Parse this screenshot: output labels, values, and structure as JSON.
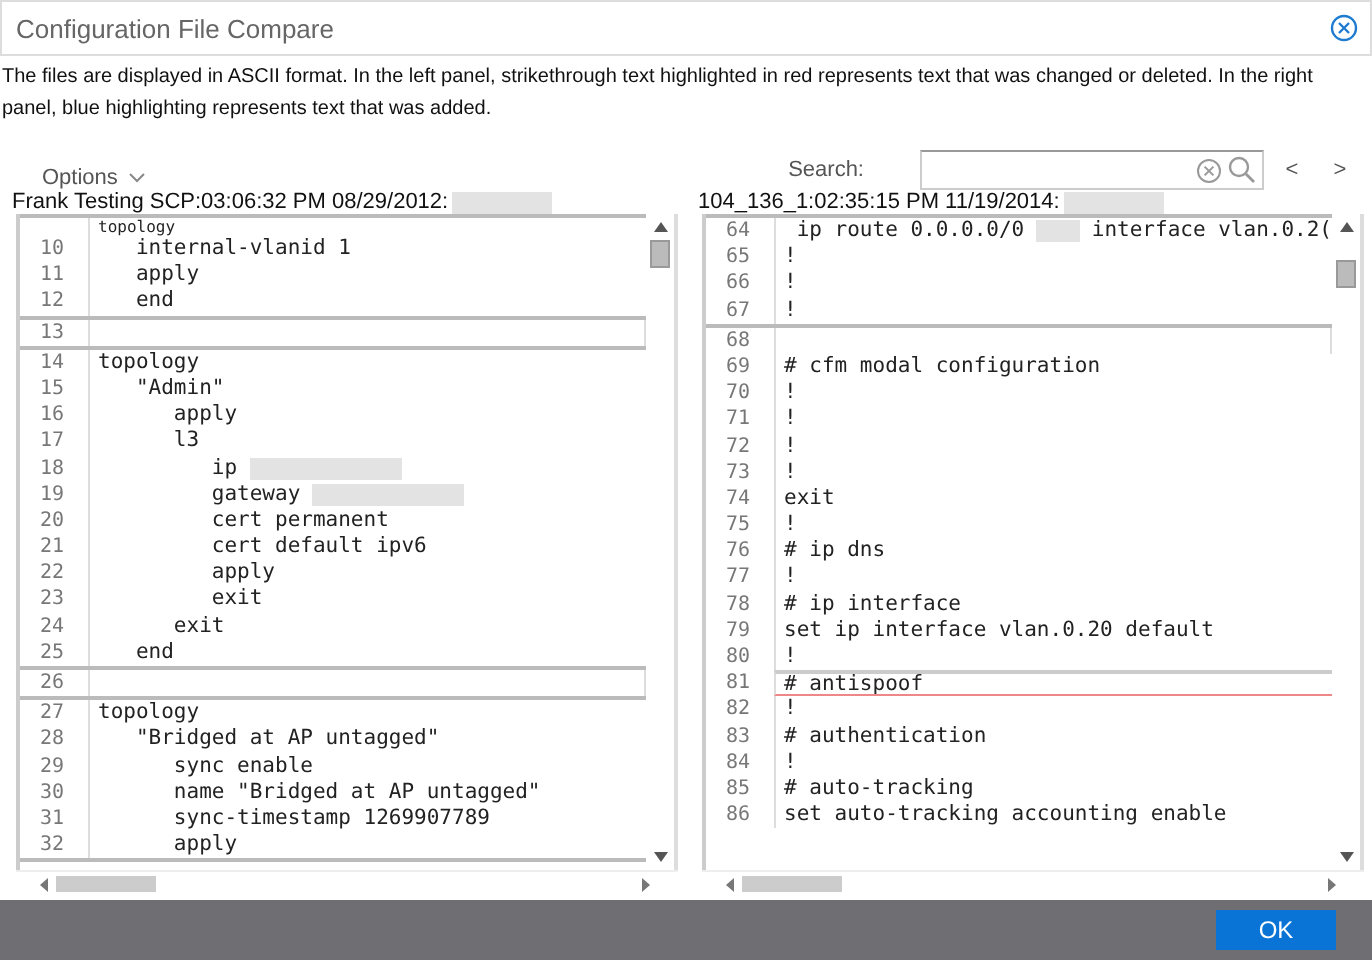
{
  "window": {
    "title": "Configuration File Compare"
  },
  "description": "The files are displayed in ASCII format. In the left panel, strikethrough text highlighted in red represents text that was changed or deleted. In the right panel, blue highlighting represents text that was added.",
  "toolbar": {
    "options": "Options",
    "search_label": "Search:",
    "prev": "<",
    "next": ">"
  },
  "panels": [
    {
      "file": "Frank Testing SCP:03:06:32 PM 08/29/2012:",
      "file_redacted": true,
      "blocks": [
        {
          "kind": "block",
          "lines": [
            {
              "parts": [
                {
                  "kind": "text",
                  "text": "topology"
                }
              ]
            },
            {
              "number": "10",
              "parts": [
                {
                  "kind": "text",
                  "text": "   internal-vlanid 1"
                }
              ]
            },
            {
              "number": "11",
              "parts": [
                {
                  "kind": "text",
                  "text": "   apply"
                }
              ]
            },
            {
              "number": "12",
              "parts": [
                {
                  "kind": "text",
                  "text": "   end"
                }
              ]
            }
          ]
        },
        {
          "kind": "gap",
          "lines": [
            {
              "number": "13"
            }
          ]
        },
        {
          "kind": "block",
          "lines": [
            {
              "number": "14",
              "parts": [
                {
                  "kind": "text",
                  "text": "topology"
                }
              ]
            },
            {
              "number": "15",
              "parts": [
                {
                  "kind": "text",
                  "text": "   \"Admin\""
                }
              ]
            },
            {
              "number": "16",
              "parts": [
                {
                  "kind": "text",
                  "text": "      apply"
                }
              ]
            },
            {
              "number": "17",
              "parts": [
                {
                  "kind": "text",
                  "text": "      l3"
                }
              ]
            },
            {
              "number": "18",
              "parts": [
                {
                  "kind": "text",
                  "text": "         ip "
                },
                {
                  "kind": "redacted"
                }
              ]
            },
            {
              "number": "19",
              "parts": [
                {
                  "kind": "text",
                  "text": "         gateway "
                },
                {
                  "kind": "redacted"
                }
              ]
            },
            {
              "number": "20",
              "parts": [
                {
                  "kind": "text",
                  "text": "         cert permanent"
                }
              ]
            },
            {
              "number": "21",
              "parts": [
                {
                  "kind": "text",
                  "text": "         cert default ipv6"
                }
              ]
            },
            {
              "number": "22",
              "parts": [
                {
                  "kind": "text",
                  "text": "         apply"
                }
              ]
            },
            {
              "number": "23",
              "parts": [
                {
                  "kind": "text",
                  "text": "         exit"
                }
              ]
            },
            {
              "number": "24",
              "parts": [
                {
                  "kind": "text",
                  "text": "      exit"
                }
              ]
            },
            {
              "number": "25",
              "parts": [
                {
                  "kind": "text",
                  "text": "   end"
                }
              ]
            }
          ]
        },
        {
          "kind": "gap",
          "lines": [
            {
              "number": "26"
            }
          ]
        },
        {
          "kind": "block",
          "lines": [
            {
              "number": "27",
              "parts": [
                {
                  "kind": "text",
                  "text": "topology"
                }
              ]
            },
            {
              "number": "28",
              "parts": [
                {
                  "kind": "text",
                  "text": "   \"Bridged at AP untagged\""
                }
              ]
            },
            {
              "number": "29",
              "parts": [
                {
                  "kind": "text",
                  "text": "      sync enable"
                }
              ]
            },
            {
              "number": "30",
              "parts": [
                {
                  "kind": "text",
                  "text": "      name \"Bridged at AP untagged\""
                }
              ]
            },
            {
              "number": "31",
              "parts": [
                {
                  "kind": "text",
                  "text": "      sync-timestamp 1269907789"
                }
              ]
            },
            {
              "number": "32",
              "parts": [
                {
                  "kind": "text",
                  "text": "      apply"
                }
              ]
            }
          ]
        }
      ]
    },
    {
      "file": "104_136_1:02:35:15 PM 11/19/2014:",
      "file_redacted": true,
      "blocks": [
        {
          "kind": "block",
          "lines": [
            {
              "number": "64",
              "parts": [
                {
                  "kind": "text",
                  "text": " ip route 0.0.0.0/0 "
                },
                {
                  "kind": "redacted"
                },
                {
                  "kind": "text",
                  "text": " interface vlan.0.2("
                }
              ]
            },
            {
              "number": "65",
              "parts": [
                {
                  "kind": "text",
                  "text": "!"
                }
              ]
            },
            {
              "number": "66",
              "parts": [
                {
                  "kind": "text",
                  "text": "!"
                }
              ]
            },
            {
              "number": "67",
              "parts": [
                {
                  "kind": "text",
                  "text": "!"
                }
              ]
            }
          ]
        },
        {
          "kind": "gap",
          "lines": [
            {
              "number": "68"
            }
          ]
        },
        {
          "kind": "plain",
          "lines": [
            {
              "number": "69",
              "parts": [
                {
                  "kind": "text",
                  "text": "# cfm modal configuration"
                }
              ]
            },
            {
              "number": "70",
              "parts": [
                {
                  "kind": "text",
                  "text": "!"
                }
              ]
            },
            {
              "number": "71",
              "parts": [
                {
                  "kind": "text",
                  "text": "!"
                }
              ]
            },
            {
              "number": "72",
              "parts": [
                {
                  "kind": "text",
                  "text": "!"
                }
              ]
            },
            {
              "number": "73",
              "parts": [
                {
                  "kind": "text",
                  "text": "!"
                }
              ]
            },
            {
              "number": "74",
              "parts": [
                {
                  "kind": "text",
                  "text": "exit"
                }
              ]
            },
            {
              "number": "75",
              "parts": [
                {
                  "kind": "text",
                  "text": "!"
                }
              ]
            },
            {
              "number": "76",
              "parts": [
                {
                  "kind": "text",
                  "text": "# ip dns"
                }
              ]
            },
            {
              "number": "77",
              "parts": [
                {
                  "kind": "text",
                  "text": "!"
                }
              ]
            },
            {
              "number": "78",
              "parts": [
                {
                  "kind": "text",
                  "text": "# ip interface"
                }
              ]
            },
            {
              "number": "79",
              "parts": [
                {
                  "kind": "text",
                  "text": "set ip interface vlan.0.20 default"
                }
              ]
            },
            {
              "number": "80",
              "parts": [
                {
                  "kind": "text",
                  "text": "!"
                }
              ]
            }
          ]
        },
        {
          "kind": "marker",
          "lines": [
            {
              "number": "81",
              "parts": [
                {
                  "kind": "text",
                  "text": "# antispoof"
                }
              ]
            }
          ]
        },
        {
          "kind": "plain",
          "lines": [
            {
              "number": "82",
              "parts": [
                {
                  "kind": "text",
                  "text": "!"
                }
              ]
            },
            {
              "number": "83",
              "parts": [
                {
                  "kind": "text",
                  "text": "# authentication"
                }
              ]
            },
            {
              "number": "84",
              "parts": [
                {
                  "kind": "text",
                  "text": "!"
                }
              ]
            },
            {
              "number": "85",
              "parts": [
                {
                  "kind": "text",
                  "text": "# auto-tracking"
                }
              ]
            },
            {
              "number": "86",
              "parts": [
                {
                  "kind": "text",
                  "text": "set auto-tracking accounting enable"
                }
              ]
            }
          ]
        }
      ]
    }
  ],
  "buttons": [
    {
      "label": "OK"
    }
  ]
}
